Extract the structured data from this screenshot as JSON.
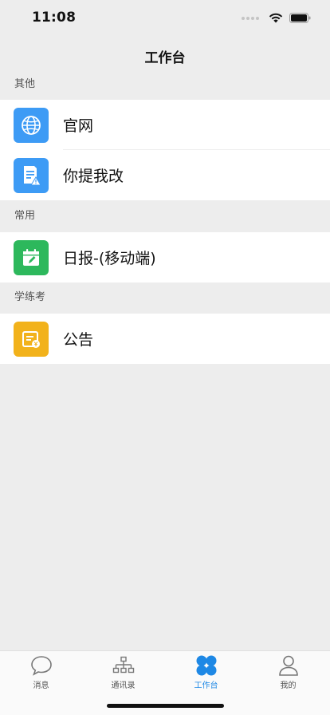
{
  "status_bar": {
    "time": "11:08"
  },
  "nav": {
    "title": "工作台"
  },
  "sections": [
    {
      "title": "其他",
      "items": [
        {
          "label": "官网",
          "icon": "globe-icon",
          "color": "#3d9bf5"
        },
        {
          "label": "你提我改",
          "icon": "document-warning-icon",
          "color": "#3d9bf5"
        }
      ]
    },
    {
      "title": "常用",
      "items": [
        {
          "label": "日报-(移动端)",
          "icon": "calendar-edit-icon",
          "color": "#2db85c"
        }
      ]
    },
    {
      "title": "学练考",
      "items": [
        {
          "label": "公告",
          "icon": "notice-icon",
          "color": "#f2b21b"
        }
      ]
    }
  ],
  "tab_bar": {
    "active": "工作台",
    "tabs": [
      {
        "label": "消息",
        "icon": "chat-bubble-icon"
      },
      {
        "label": "通讯录",
        "icon": "org-chart-icon"
      },
      {
        "label": "工作台",
        "icon": "grid-icon"
      },
      {
        "label": "我的",
        "icon": "user-icon"
      }
    ]
  }
}
